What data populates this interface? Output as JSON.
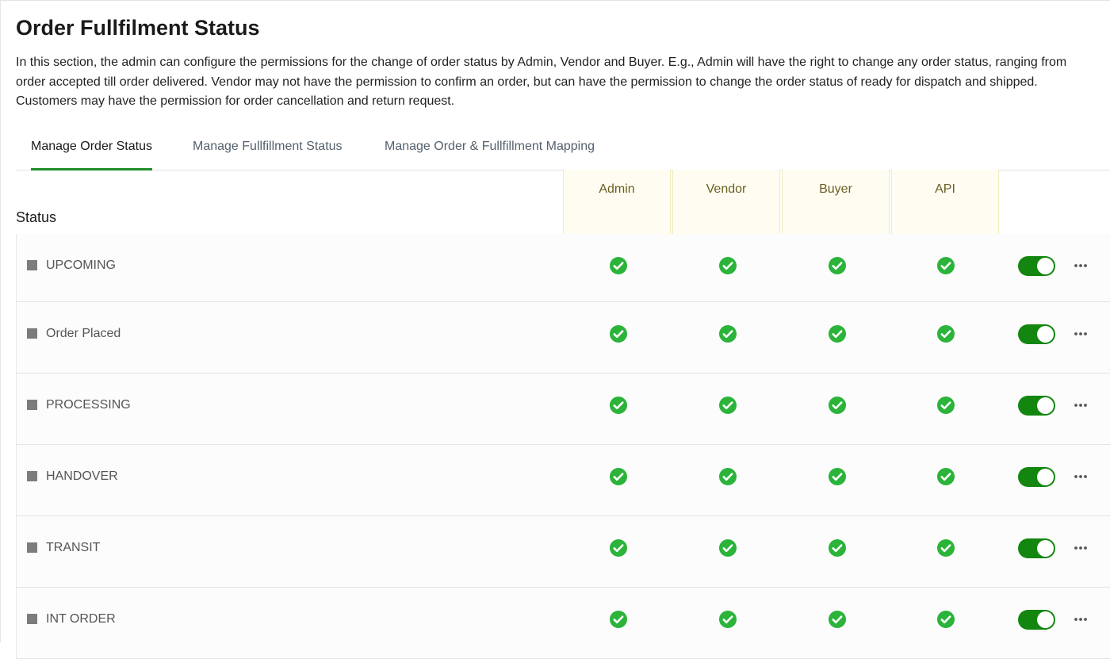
{
  "page": {
    "title": "Order Fullfilment Status",
    "description": "In this section, the admin can configure the permissions for the change of order status by Admin, Vendor and Buyer. E.g., Admin will have the right to change any order status, ranging from order accepted till order delivered. Vendor may not have the permission to confirm an order, but can have the permission to change the order status of ready for dispatch and shipped. Customers may have the permission for order cancellation and return request."
  },
  "tabs": [
    {
      "label": "Manage Order Status",
      "active": true
    },
    {
      "label": "Manage Fullfillment Status",
      "active": false
    },
    {
      "label": "Manage Order & Fullfillment Mapping",
      "active": false
    }
  ],
  "table": {
    "status_header": "Status",
    "columns": [
      "Admin",
      "Vendor",
      "Buyer",
      "API"
    ],
    "rows": [
      {
        "label": "UPCOMING",
        "permissions": [
          true,
          true,
          true,
          true
        ],
        "enabled": true
      },
      {
        "label": "Order Placed",
        "permissions": [
          true,
          true,
          true,
          true
        ],
        "enabled": true
      },
      {
        "label": "PROCESSING",
        "permissions": [
          true,
          true,
          true,
          true
        ],
        "enabled": true
      },
      {
        "label": "HANDOVER",
        "permissions": [
          true,
          true,
          true,
          true
        ],
        "enabled": true
      },
      {
        "label": "TRANSIT",
        "permissions": [
          true,
          true,
          true,
          true
        ],
        "enabled": true
      },
      {
        "label": "INT ORDER",
        "permissions": [
          true,
          true,
          true,
          true
        ],
        "enabled": true
      }
    ]
  },
  "icons": {
    "check": "check-circle-icon",
    "more": "more-horizontal-icon",
    "status_marker": "square-icon"
  },
  "colors": {
    "accent": "#1e8f2a",
    "check": "#2bb33a",
    "toggle_on": "#13860f",
    "column_highlight": "#fffdf1",
    "column_header_text": "#6b5e22"
  }
}
